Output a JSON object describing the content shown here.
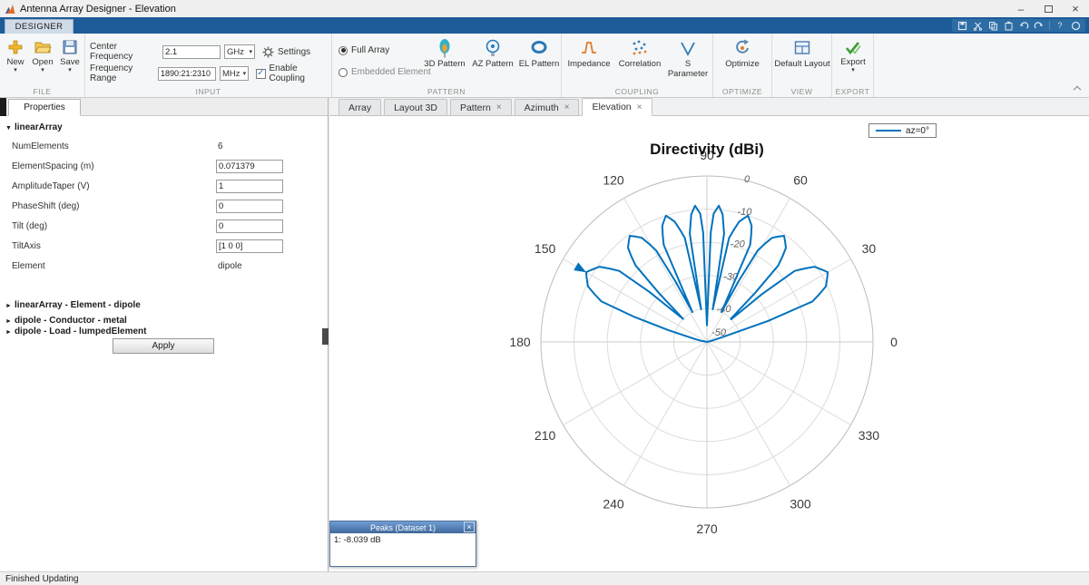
{
  "window": {
    "title": "Antenna Array Designer - Elevation"
  },
  "icons": {
    "caret_down": "▾",
    "expanded": "▼",
    "collapsed": "►",
    "close": "×",
    "check": "✓",
    "minimize": "–",
    "help": "?"
  },
  "quick_access": {
    "icons": [
      "save",
      "cut",
      "copy",
      "paste",
      "undo",
      "redo",
      "help",
      "circle"
    ]
  },
  "toolstrip": {
    "tab_label": "DESIGNER",
    "file": {
      "label": "FILE",
      "new": "New",
      "open": "Open",
      "save": "Save"
    },
    "input": {
      "label": "INPUT",
      "center_frequency_label": "Center Frequency",
      "center_frequency_value": "2.1",
      "center_frequency_unit": "GHz",
      "settings_label": "Settings",
      "frequency_range_label": "Frequency Range",
      "frequency_range_value": "1890:21:2310",
      "frequency_range_unit": "MHz",
      "enable_coupling_label": "Enable Coupling"
    },
    "pattern": {
      "label": "PATTERN",
      "full_array_label": "Full Array",
      "embedded_element_label": "Embedded Element",
      "pattern3d_label": "3D Pattern",
      "az_pattern_label": "AZ Pattern",
      "el_pattern_label": "EL Pattern"
    },
    "coupling": {
      "label": "COUPLING",
      "impedance_label": "Impedance",
      "correlation_label": "Correlation",
      "sparameter_label": "S Parameter"
    },
    "optimize": {
      "label": "OPTIMIZE",
      "optimize_label": "Optimize"
    },
    "view": {
      "label": "VIEW",
      "default_layout_label": "Default Layout"
    },
    "export": {
      "label": "EXPORT",
      "export_label": "Export"
    }
  },
  "properties_panel": {
    "tab_label": "Properties",
    "group_title": "linearArray",
    "rows": [
      {
        "label": "NumElements",
        "value": "6"
      },
      {
        "label": "ElementSpacing (m)",
        "value": "0.071379"
      },
      {
        "label": "AmplitudeTaper (V)",
        "value": "1"
      },
      {
        "label": "PhaseShift (deg)",
        "value": "0"
      },
      {
        "label": "Tilt (deg)",
        "value": "0"
      },
      {
        "label": "TiltAxis",
        "value": "[1 0 0]"
      },
      {
        "label": "Element",
        "value": "dipole"
      }
    ],
    "collapsed_groups": [
      "linearArray - Element - dipole",
      "dipole - Conductor - metal",
      "dipole - Load - lumpedElement"
    ],
    "apply_label": "Apply"
  },
  "doc_tabs": [
    {
      "label": "Array"
    },
    {
      "label": "Layout 3D"
    },
    {
      "label": "Pattern"
    },
    {
      "label": "Azimuth"
    },
    {
      "label": "Elevation"
    }
  ],
  "chart_data": {
    "type": "polar-line",
    "title": "Directivity (dBi)",
    "legend_position": "top-right",
    "grid": true,
    "angle_ticks_deg": [
      0,
      30,
      60,
      90,
      120,
      150,
      180,
      210,
      240,
      270,
      300,
      330
    ],
    "r_ticks_db": [
      0,
      -10,
      -20,
      -30,
      -40,
      -50
    ],
    "r_range_db": [
      -50,
      0
    ],
    "radial_label_angle_deg": 78,
    "series": [
      {
        "name": "az=0°",
        "color": "#0072bd",
        "points": [
          [
            0,
            -50
          ],
          [
            10,
            -50
          ],
          [
            15,
            -48
          ],
          [
            17,
            -45
          ],
          [
            21,
            -16
          ],
          [
            25,
            -10.5
          ],
          [
            30,
            -8
          ],
          [
            35,
            -10.5
          ],
          [
            39,
            -16
          ],
          [
            43,
            -40
          ],
          [
            44,
            -40
          ],
          [
            47,
            -18.5
          ],
          [
            50,
            -13
          ],
          [
            54,
            -10.5
          ],
          [
            58,
            -13
          ],
          [
            61,
            -18.5
          ],
          [
            64,
            -40
          ],
          [
            66,
            -18
          ],
          [
            69,
            -12.5
          ],
          [
            72,
            -10
          ],
          [
            75,
            -12.5
          ],
          [
            78,
            -18
          ],
          [
            80,
            -40
          ],
          [
            81,
            -17
          ],
          [
            83,
            -11.3
          ],
          [
            85,
            -8.8
          ],
          [
            87,
            -11.3
          ],
          [
            88,
            -17
          ],
          [
            90,
            -45
          ],
          [
            92,
            -17
          ],
          [
            93,
            -11.3
          ],
          [
            95,
            -8.8
          ],
          [
            97,
            -11.3
          ],
          [
            99,
            -17
          ],
          [
            100,
            -40
          ],
          [
            102,
            -18
          ],
          [
            105,
            -12.5
          ],
          [
            108,
            -10
          ],
          [
            111,
            -12.5
          ],
          [
            114,
            -18
          ],
          [
            116,
            -40
          ],
          [
            119,
            -18.5
          ],
          [
            122,
            -13
          ],
          [
            126,
            -10.5
          ],
          [
            130,
            -13
          ],
          [
            133,
            -18.5
          ],
          [
            136,
            -40
          ],
          [
            137,
            -38
          ],
          [
            141,
            -16
          ],
          [
            145,
            -10.5
          ],
          [
            150,
            -8
          ],
          [
            155,
            -10.5
          ],
          [
            159,
            -16
          ],
          [
            163,
            -38
          ],
          [
            165,
            -45
          ],
          [
            170,
            -50
          ],
          [
            180,
            -50
          ],
          [
            210,
            -50
          ],
          [
            240,
            -50
          ],
          [
            270,
            -50
          ],
          [
            300,
            -50
          ],
          [
            330,
            -50
          ],
          [
            360,
            -50
          ]
        ]
      }
    ],
    "peak_marker": {
      "theta_deg": 150,
      "db": -8.039
    }
  },
  "peaks_window": {
    "title": "Peaks (Dataset 1)",
    "row": "1: -8.039 dB"
  },
  "statusbar": {
    "text": "Finished Updating"
  },
  "colors": {
    "accent_blue": "#0072bd",
    "band_blue": "#1d5c99"
  }
}
